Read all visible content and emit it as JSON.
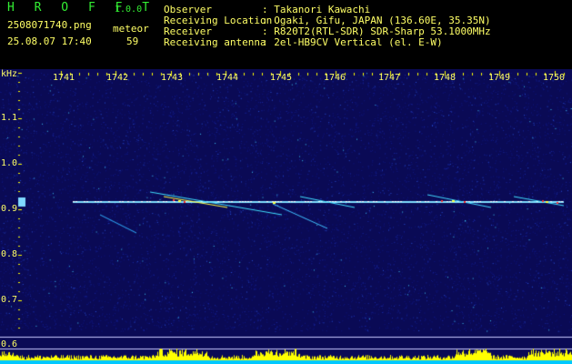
{
  "app": {
    "title": "H R O F F T",
    "version": "1.0.0"
  },
  "file": {
    "name": "2508071740.png",
    "datetime": "25.08.07 17:40"
  },
  "meteor": {
    "label": "meteor",
    "count": "59"
  },
  "station": [
    {
      "label": "Observer",
      "value": ": Takanori Kawachi"
    },
    {
      "label": "Receiving Location",
      "value": ": Ogaki, Gifu, JAPAN (136.60E, 35.35N)"
    },
    {
      "label": "Receiver",
      "value": ": R820T2(RTL-SDR) SDR-Sharp 53.1000MHz"
    },
    {
      "label": "Receiving antenna",
      "value": ": 2el-HB9CV Vertical (el. E-W)"
    }
  ],
  "spectrogram": {
    "y_unit": "kHz",
    "y_ticks": [
      "1.1",
      "1.0",
      "0.9",
      "0.8",
      "0.7",
      "0.6"
    ],
    "x_ticks": [
      "1741",
      "1742",
      "1743",
      "1744",
      "1745",
      "1746",
      "1747",
      "1748",
      "1749",
      "1750"
    ],
    "carrier_khz": 0.915,
    "colors": {
      "background": "#0a0a55",
      "label": "#ffff66",
      "trace": "#ffff00",
      "carrier": "#80e0ff",
      "baseline": "#00c8ff"
    }
  }
}
